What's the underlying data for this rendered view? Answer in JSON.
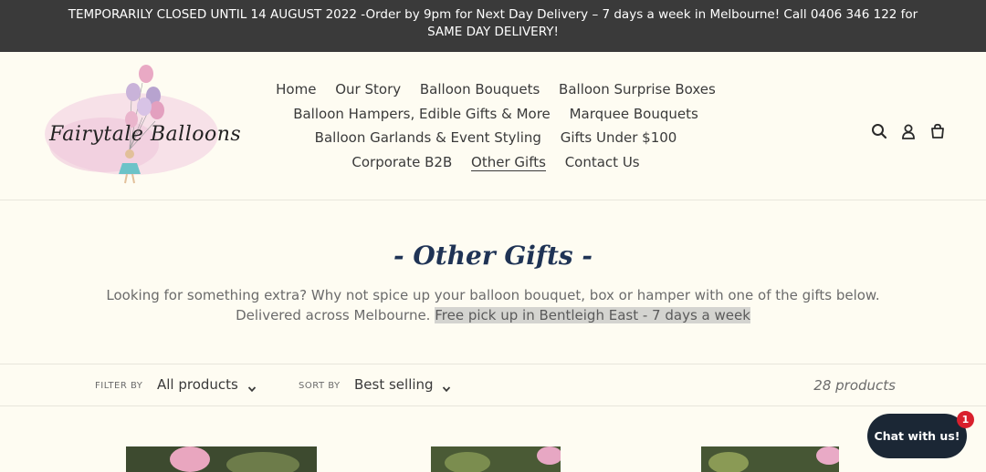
{
  "announcement": "TEMPORARILY CLOSED UNTIL 14 AUGUST 2022 -Order by 9pm for Next Day Delivery – 7 days a week in Melbourne! Call 0406 346 122 for SAME DAY DELIVERY!",
  "logo": {
    "text": "Fairytale Balloons"
  },
  "nav": {
    "row1": [
      "Home",
      "Our Story",
      "Balloon Bouquets",
      "Balloon Surprise Boxes"
    ],
    "row2": [
      "Balloon Hampers, Edible Gifts & More",
      "Marquee Bouquets"
    ],
    "row3": [
      "Balloon Garlands & Event Styling",
      "Gifts Under $100"
    ],
    "row4": [
      "Corporate B2B",
      "Other Gifts",
      "Contact Us"
    ],
    "active": "Other Gifts"
  },
  "header_icons": [
    "search-icon",
    "account-icon",
    "cart-icon"
  ],
  "collection": {
    "title": "- Other Gifts -",
    "description_line1": "Looking for something extra? Why not spice up your balloon bouquet, box or hamper with one of the gifts below.",
    "description_line2_plain": "Delivered across Melbourne. ",
    "description_line2_highlight": "Free pick up in Bentleigh East - 7 days a week"
  },
  "filters": {
    "filter_label": "FILTER BY",
    "filter_value": "All products",
    "sort_label": "SORT BY",
    "sort_value": "Best selling",
    "product_count": "28 products"
  },
  "chat": {
    "label": "Chat with us!",
    "badge": "1"
  },
  "colors": {
    "announce_bg": "#3a3a3a",
    "page_bg": "#fefcf2",
    "title": "#1f3355",
    "chat_bg": "#1b2735",
    "badge": "#d9202d"
  }
}
